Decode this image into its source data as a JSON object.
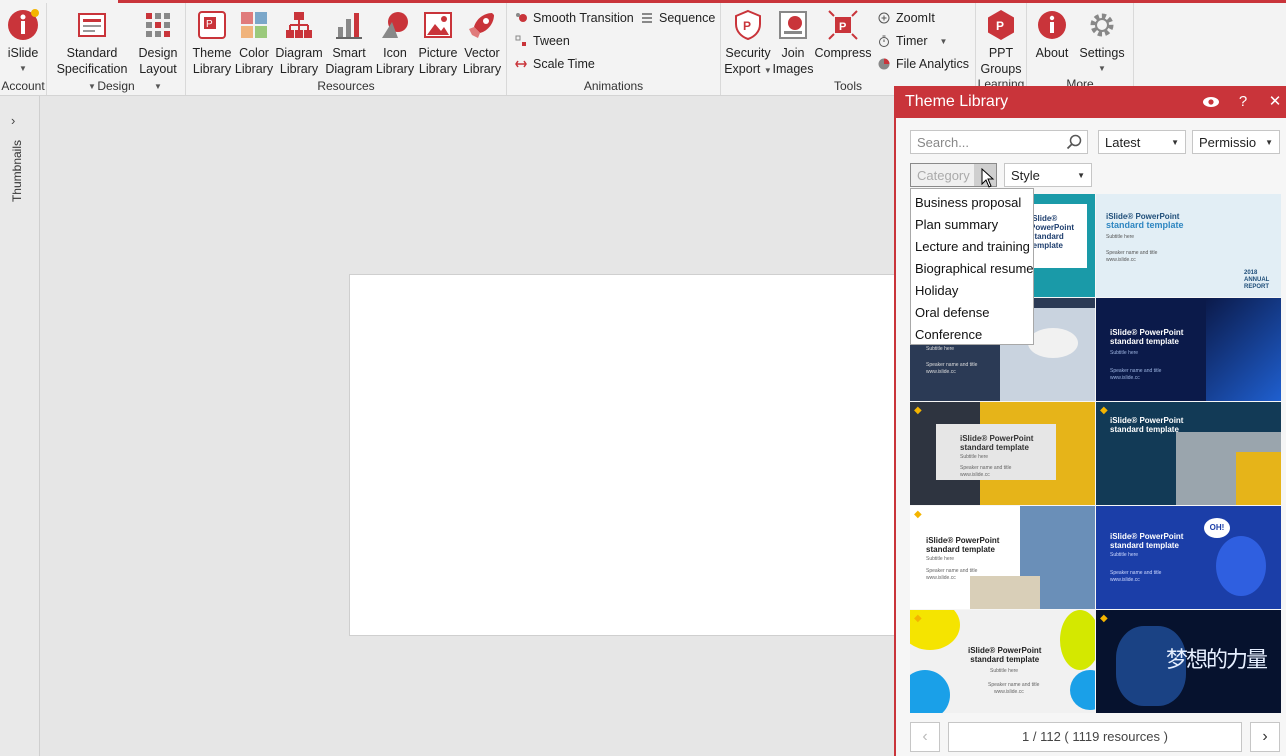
{
  "ribbon": {
    "groups": [
      {
        "label": "Account"
      },
      {
        "label": "Design"
      },
      {
        "label": "Resources"
      },
      {
        "label": "Animations"
      },
      {
        "label": "Tools"
      },
      {
        "label": "Learning"
      },
      {
        "label": "More"
      }
    ],
    "buttons": {
      "islide": "iSlide",
      "standard_spec_1": "Standard",
      "standard_spec_2": "Specification",
      "design_layout_1": "Design",
      "design_layout_2": "Layout",
      "theme_lib_1": "Theme",
      "theme_lib_2": "Library",
      "color_lib_1": "Color",
      "color_lib_2": "Library",
      "diagram_lib_1": "Diagram",
      "diagram_lib_2": "Library",
      "smart_diagram_1": "Smart",
      "smart_diagram_2": "Diagram",
      "icon_lib_1": "Icon",
      "icon_lib_2": "Library",
      "picture_lib_1": "Picture",
      "picture_lib_2": "Library",
      "vector_lib_1": "Vector",
      "vector_lib_2": "Library",
      "smooth_transition": "Smooth Transition",
      "sequence": "Sequence",
      "tween": "Tween",
      "scale_time": "Scale Time",
      "security_export_1": "Security",
      "security_export_2": "Export",
      "join_images_1": "Join",
      "join_images_2": "Images",
      "compress": "Compress",
      "zoomit": "ZoomIt",
      "timer": "Timer",
      "file_analytics": "File Analytics",
      "ppt_groups_1": "PPT",
      "ppt_groups_2": "Groups",
      "about": "About",
      "settings": "Settings"
    }
  },
  "thumbnails_label": "Thumbnails",
  "panel": {
    "title": "Theme Library",
    "search_placeholder": "Search...",
    "sort_value": "Latest",
    "permission_value": "Permissio",
    "category_placeholder": "Category",
    "style_value": "Style",
    "category_options": [
      "Business proposal",
      "Plan summary",
      "Lecture and training",
      "Biographical resume",
      "Holiday",
      "Oral defense",
      "Conference"
    ],
    "tile_text": {
      "brand": "iSlide® PowerPoint",
      "sub": "standard template",
      "subtitle": "Subtitle here",
      "speaker": "Speaker name and title",
      "url": "www.islide.cc",
      "annual_1": "2018",
      "annual_2": "ANNUAL",
      "annual_3": "REPORT",
      "oh": "OH!",
      "cn": "梦想的力量"
    },
    "pager_text": "1 / 112 ( 1119 resources )"
  },
  "colors": {
    "accent": "#c9343a"
  }
}
